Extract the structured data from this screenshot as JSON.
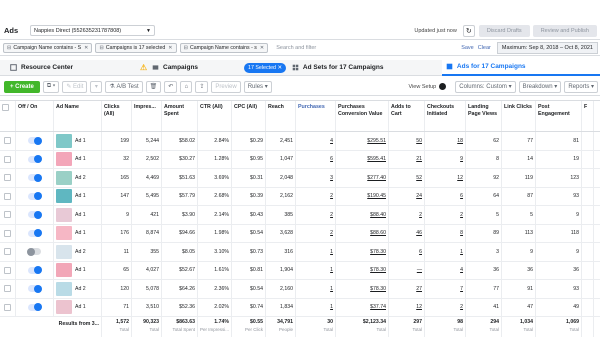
{
  "topbar": {
    "title": "Ads",
    "account": "Nappies Direct (552635231787808)",
    "updated": "Updated just now",
    "discard": "Discard Drafts",
    "review": "Review and Publish"
  },
  "filters": {
    "chips": [
      "Campaign Name contains - S",
      "Campaigns is 17 selected",
      "Campaign Name contains - s"
    ],
    "search_placeholder": "Search and filter",
    "save": "Save",
    "clear": "Clear",
    "date_range": "Maximum: Sep 8, 2018 – Oct 8, 2021"
  },
  "levels": {
    "resource_center": "Resource Center",
    "campaigns": "Campaigns",
    "selected": "17 Selected",
    "adsets": "Ad Sets for 17 Campaigns",
    "ads": "Ads for 17 Campaigns"
  },
  "toolbar": {
    "create": "+ Create",
    "edit": "✎ Edit",
    "ab_test": "A/B Test",
    "preview": "Preview",
    "rules": "Rules ▾",
    "view_setup": "View Setup",
    "columns": "Columns: Custom ▾",
    "breakdown": "Breakdown ▾",
    "reports": "Reports ▾"
  },
  "headers": [
    "Off / On",
    "Ad Name",
    "Clicks (All)",
    "Impres...",
    "Amount Spent",
    "CTR (All)",
    "CPC (All)",
    "Reach",
    "Purchases",
    "Purchases Conversion Value",
    "Adds to Cart",
    "Checkouts Initiated",
    "Landing Page Views",
    "Link Clicks",
    "Post Engagement",
    "F"
  ],
  "rows": [
    {
      "on": true,
      "thumb": "#7fc8c8",
      "name": "Ad 1",
      "clicks": "199",
      "impr": "5,244",
      "spent": "$58.02",
      "ctr": "2.84%",
      "cpc": "$0.29",
      "reach": "2,451",
      "purch": "4",
      "pcv": "$295.51",
      "atc": "50",
      "chk": "18",
      "lpv": "62",
      "lc": "77",
      "pe": "81"
    },
    {
      "on": true,
      "thumb": "#f3a6b9",
      "name": "Ad 1",
      "clicks": "32",
      "impr": "2,502",
      "spent": "$30.27",
      "ctr": "1.28%",
      "cpc": "$0.95",
      "reach": "1,047",
      "purch": "6",
      "pcv": "$595.41",
      "atc": "21",
      "chk": "9",
      "lpv": "8",
      "lc": "14",
      "pe": "19"
    },
    {
      "on": true,
      "thumb": "#9ad0c6",
      "name": "Ad 2",
      "clicks": "165",
      "impr": "4,469",
      "spent": "$51.63",
      "ctr": "3.69%",
      "cpc": "$0.31",
      "reach": "2,048",
      "purch": "3",
      "pcv": "$277.40",
      "atc": "52",
      "chk": "12",
      "lpv": "92",
      "lc": "119",
      "pe": "123"
    },
    {
      "on": true,
      "thumb": "#5fb7c1",
      "name": "Ad 1",
      "clicks": "147",
      "impr": "5,495",
      "spent": "$57.79",
      "ctr": "2.68%",
      "cpc": "$0.39",
      "reach": "2,162",
      "purch": "2",
      "pcv": "$190.45",
      "atc": "24",
      "chk": "6",
      "lpv": "64",
      "lc": "87",
      "pe": "93"
    },
    {
      "on": true,
      "thumb": "#e8c9d6",
      "name": "Ad 1",
      "clicks": "9",
      "impr": "421",
      "spent": "$3.90",
      "ctr": "2.14%",
      "cpc": "$0.43",
      "reach": "385",
      "purch": "2",
      "pcv": "$88.40",
      "atc": "2",
      "chk": "2",
      "lpv": "5",
      "lc": "5",
      "pe": "9"
    },
    {
      "on": true,
      "thumb": "#f6b7c5",
      "name": "Ad 1",
      "clicks": "176",
      "impr": "8,874",
      "spent": "$94.66",
      "ctr": "1.98%",
      "cpc": "$0.54",
      "reach": "3,628",
      "purch": "2",
      "pcv": "$88.60",
      "atc": "46",
      "chk": "8",
      "lpv": "89",
      "lc": "113",
      "pe": "118"
    },
    {
      "on": false,
      "thumb": "#d8e4ec",
      "name": "Ad 2",
      "clicks": "11",
      "impr": "355",
      "spent": "$8.05",
      "ctr": "3.10%",
      "cpc": "$0.73",
      "reach": "316",
      "purch": "1",
      "pcv": "$78.30",
      "atc": "6",
      "chk": "1",
      "lpv": "3",
      "lc": "9",
      "pe": "9"
    },
    {
      "on": true,
      "thumb": "#f2a7b8",
      "name": "Ad 1",
      "clicks": "65",
      "impr": "4,027",
      "spent": "$52.67",
      "ctr": "1.61%",
      "cpc": "$0.81",
      "reach": "1,904",
      "purch": "1",
      "pcv": "$78.30",
      "atc": "—",
      "chk": "4",
      "lpv": "36",
      "lc": "36",
      "pe": "36"
    },
    {
      "on": true,
      "thumb": "#b9dbe6",
      "name": "Ad 2",
      "clicks": "120",
      "impr": "5,078",
      "spent": "$64.26",
      "ctr": "2.36%",
      "cpc": "$0.54",
      "reach": "2,160",
      "purch": "1",
      "pcv": "$78.30",
      "atc": "27",
      "chk": "7",
      "lpv": "77",
      "lc": "91",
      "pe": "93"
    },
    {
      "on": true,
      "thumb": "#ecc3cf",
      "name": "Ad 1",
      "clicks": "71",
      "impr": "3,510",
      "spent": "$52.36",
      "ctr": "2.02%",
      "cpc": "$0.74",
      "reach": "1,834",
      "purch": "1",
      "pcv": "$37.74",
      "atc": "12",
      "chk": "2",
      "lpv": "41",
      "lc": "47",
      "pe": "49"
    }
  ],
  "totals": {
    "label": "Results from 3...",
    "values": [
      "1,572",
      "90,323",
      "$863.63",
      "1.74%",
      "$0.55",
      "34,791",
      "30",
      "$2,123.34",
      "297",
      "98",
      "294",
      "1,034",
      "1,069"
    ],
    "sublabels": [
      "Total",
      "Total",
      "Total Spent",
      "Per Impressi...",
      "Per Click",
      "People",
      "Total",
      "Total",
      "Total",
      "Total",
      "Total",
      "Total",
      "Total"
    ]
  }
}
